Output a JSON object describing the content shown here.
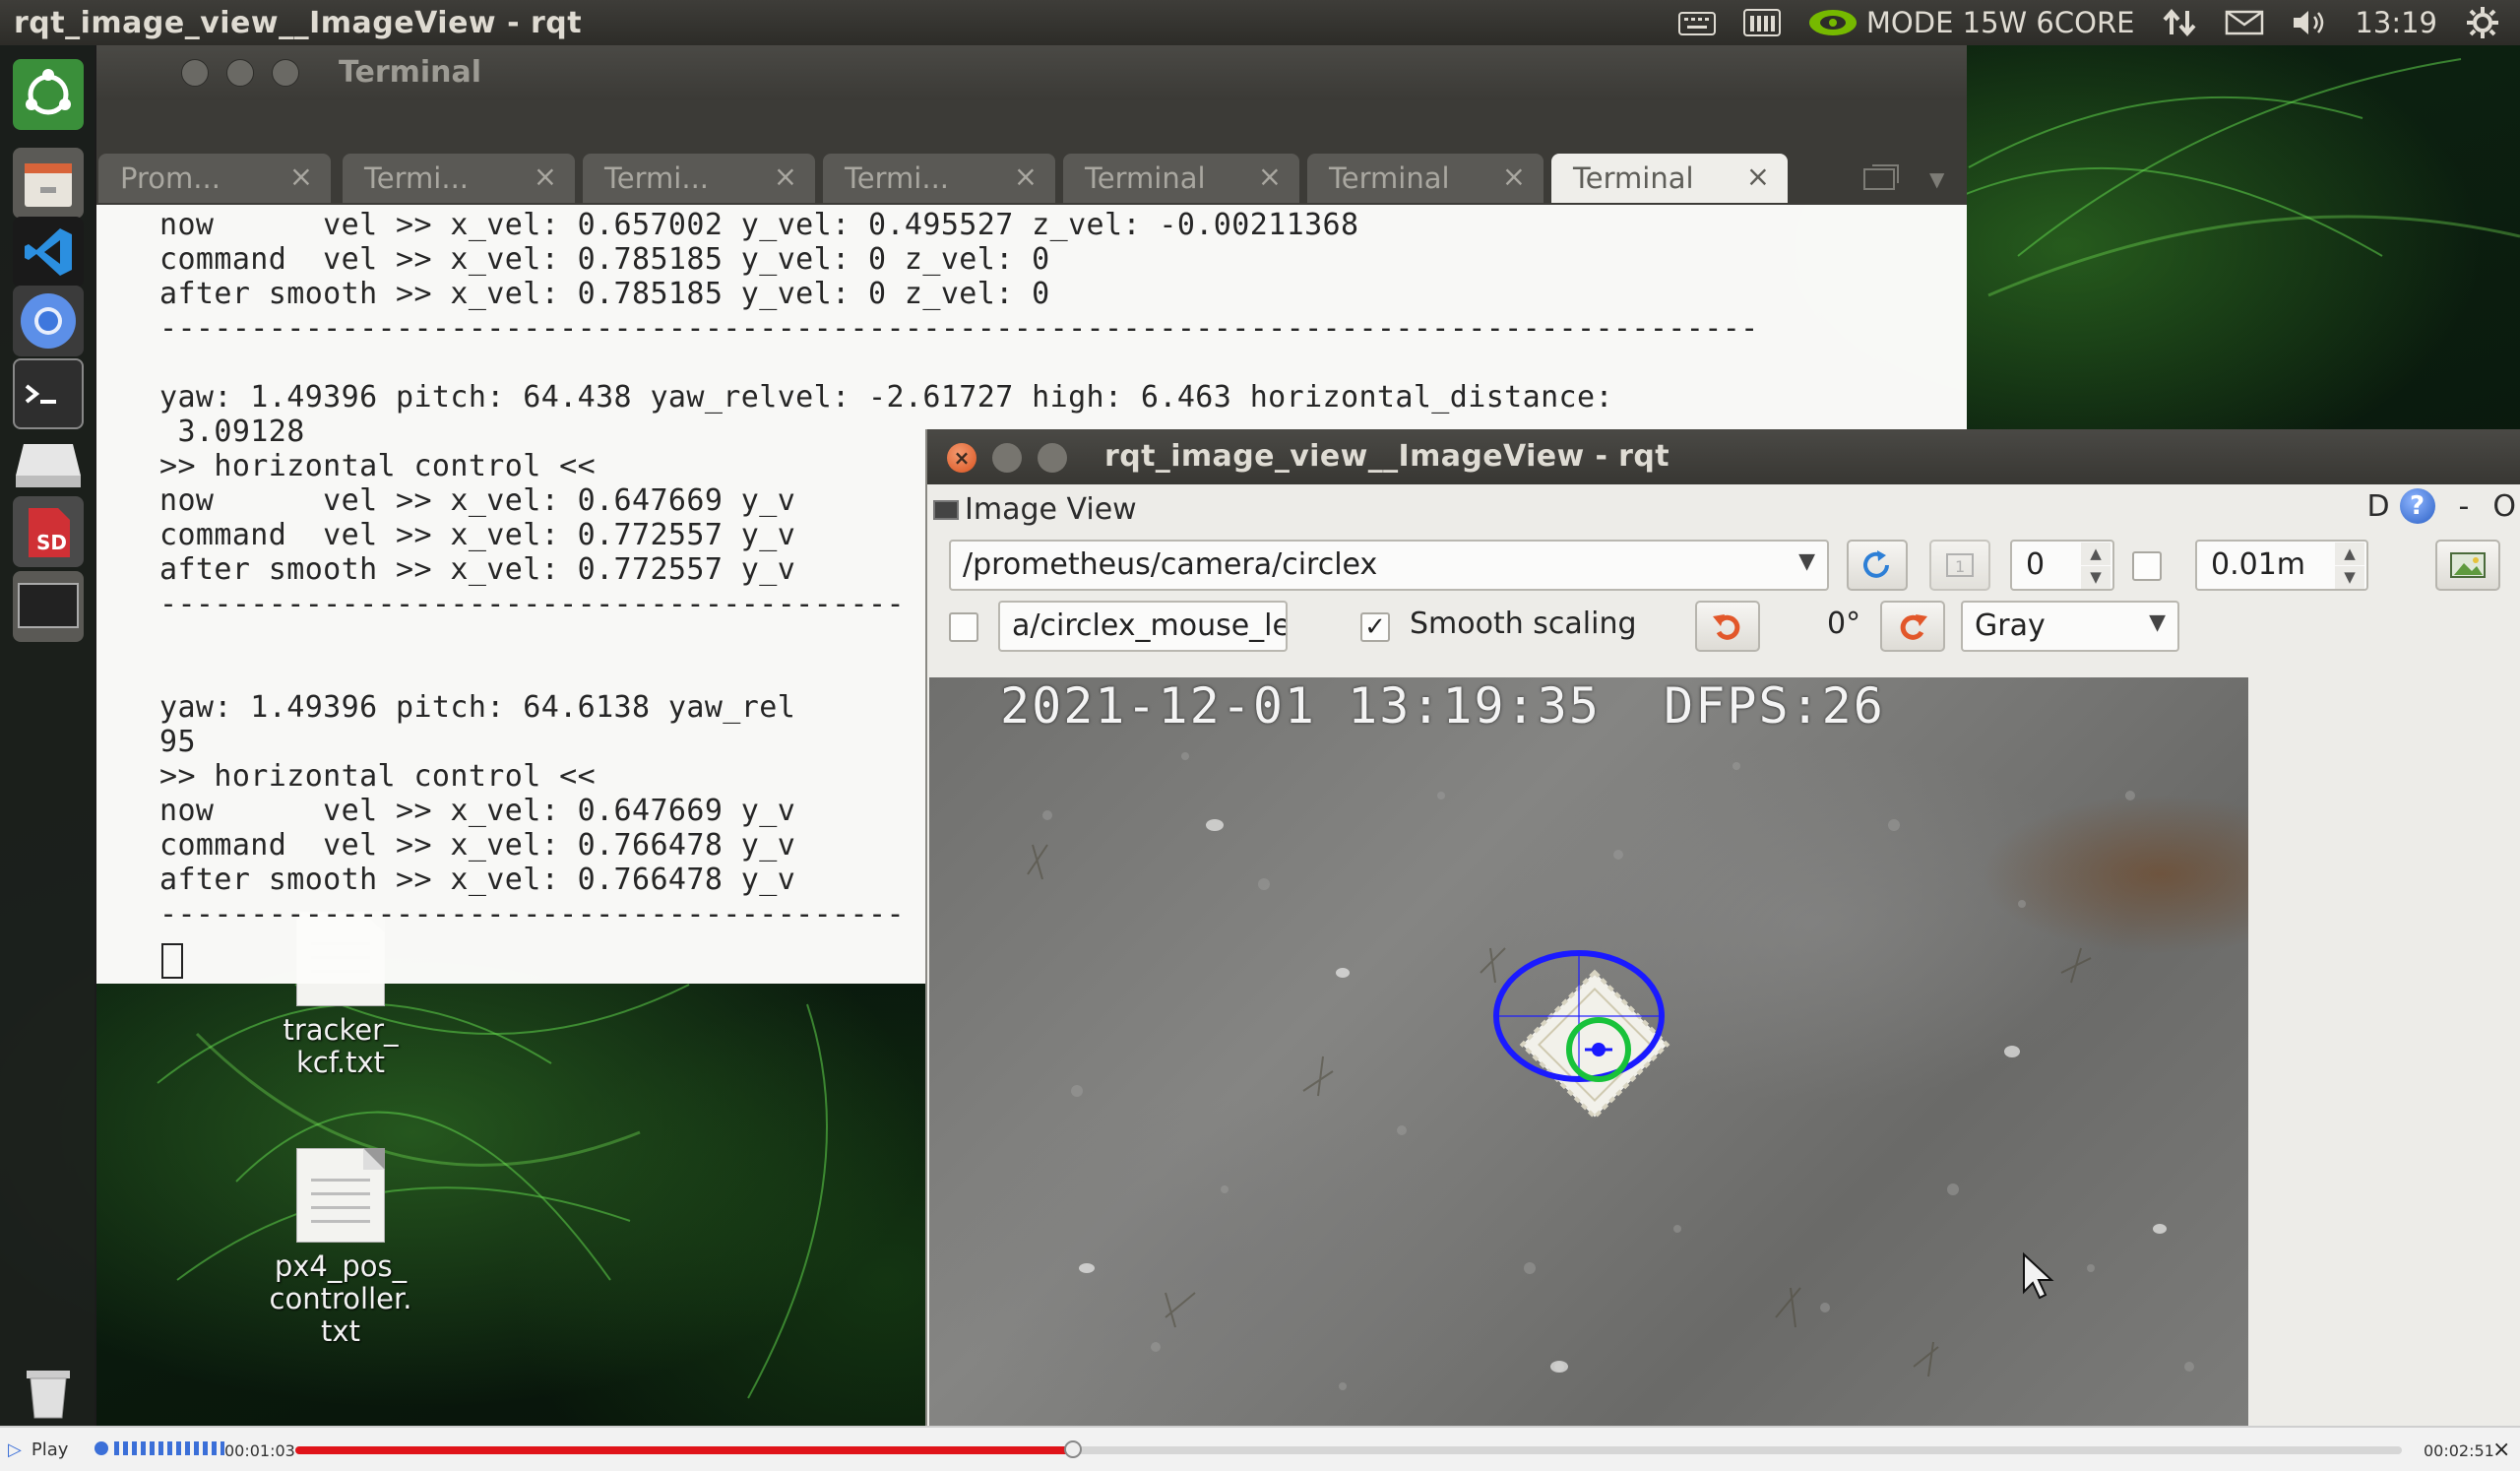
{
  "top_panel": {
    "window_title": "rqt_image_view__ImageView - rqt",
    "power_mode": "MODE 15W 6CORE",
    "clock": "13:19"
  },
  "launcher": {
    "items": [
      "ubuntu-home-icon",
      "file-manager-icon",
      "vscode-icon",
      "chromium-icon",
      "terminal-icon",
      "drive-icon",
      "sd-card-icon",
      "screen-icon",
      "trash-icon"
    ],
    "sd_label": "SD"
  },
  "desktop_files": [
    {
      "name": "tracker_\nkcf.txt"
    },
    {
      "name": "px4_pos_\ncontroller.\ntxt"
    }
  ],
  "terminal": {
    "title": "Terminal",
    "tabs": [
      {
        "label": "Prom..."
      },
      {
        "label": "Termi..."
      },
      {
        "label": "Termi..."
      },
      {
        "label": "Termi..."
      },
      {
        "label": "Terminal"
      },
      {
        "label": "Terminal"
      },
      {
        "label": "Terminal",
        "active": true
      }
    ],
    "lines": [
      "now      vel >> x_vel: 0.657002 y_vel: 0.495527 z_vel: -0.00211368",
      "command  vel >> x_vel: 0.785185 y_vel: 0 z_vel: 0",
      "after smooth >> x_vel: 0.785185 y_vel: 0 z_vel: 0",
      "----------------------------------------------------------------------------------------",
      "",
      "",
      "yaw: 1.49396 pitch: 64.438 yaw_relvel: -2.61727 high: 6.463 horizontal_distance:",
      " 3.09128",
      ">> horizontal control <<",
      "now      vel >> x_vel: 0.647669 y_v",
      "command  vel >> x_vel: 0.772557 y_v",
      "after smooth >> x_vel: 0.772557 y_v",
      "-----------------------------------------",
      "",
      "",
      "yaw: 1.49396 pitch: 64.6138 yaw_rel",
      "95",
      ">> horizontal control <<",
      "now      vel >> x_vel: 0.647669 y_v",
      "command  vel >> x_vel: 0.766478 y_v",
      "after smooth >> x_vel: 0.766478 y_v",
      "-----------------------------------------"
    ]
  },
  "rqt": {
    "title": "rqt_image_view__ImageView - rqt",
    "plugin_title": "Image View",
    "dock_controls": {
      "d": "D",
      "help": "?",
      "min": "-",
      "close": "O"
    },
    "topic": "/prometheus/camera/circlex",
    "spin_value": "0",
    "distance_value": "0.01m",
    "mouse_topic": "a/circlex_mouse_left",
    "smooth_scaling_label": "Smooth scaling",
    "smooth_scaling_checked": true,
    "rotation": "0°",
    "color_scheme": "Gray",
    "camera_overlay": "2021-12-01 13:19:35  DFPS:26"
  },
  "player": {
    "play_label": "Play",
    "elapsed": "00:01:03",
    "total": "00:02:51",
    "progress": 0.369
  },
  "colors": {
    "accent_orange": "#e2572a",
    "progress_red": "#e0141a",
    "target_blue": "#1a1aff",
    "target_green": "#18c23a"
  }
}
